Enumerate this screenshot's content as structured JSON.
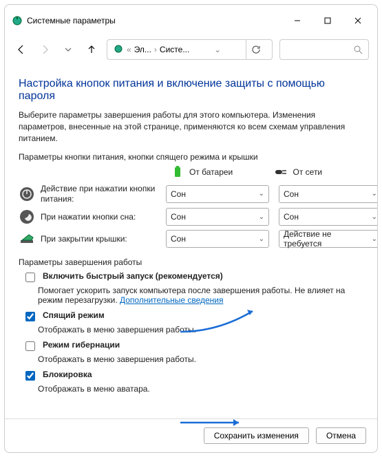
{
  "title": "Системные параметры",
  "breadcrumb": {
    "part1": "Эл...",
    "part2": "Систе..."
  },
  "heading": "Настройка кнопок питания и включение защиты с помощью пароля",
  "description": "Выберите параметры завершения работы для этого компьютера. Изменения параметров, внесенные на этой странице, применяются ко всем схемам управления питанием.",
  "section1_label": "Параметры кнопки питания, кнопки спящего режима и крышки",
  "col_battery": "От батареи",
  "col_ac": "От сети",
  "row_power_button": "Действие при нажатии кнопки питания:",
  "row_sleep_button": "При нажатии кнопки сна:",
  "row_lid": "При закрытии крышки:",
  "select_sleep": "Сон",
  "select_noaction": "Действие не требуется",
  "section2_label": "Параметры завершения работы",
  "fast_startup": {
    "label": "Включить быстрый запуск (рекомендуется)",
    "desc_prefix": "Помогает ускорить запуск компьютера после завершения работы. Не влияет на режим перезагрузки. ",
    "link": "Дополнительные сведения"
  },
  "sleep_mode": {
    "label": "Спящий режим",
    "desc": "Отображать в меню завершения работы."
  },
  "hibernate": {
    "label": "Режим гибернации",
    "desc": "Отображать в меню завершения работы."
  },
  "lock": {
    "label": "Блокировка",
    "desc": "Отображать в меню аватара."
  },
  "save_btn": "Сохранить изменения",
  "cancel_btn": "Отмена"
}
